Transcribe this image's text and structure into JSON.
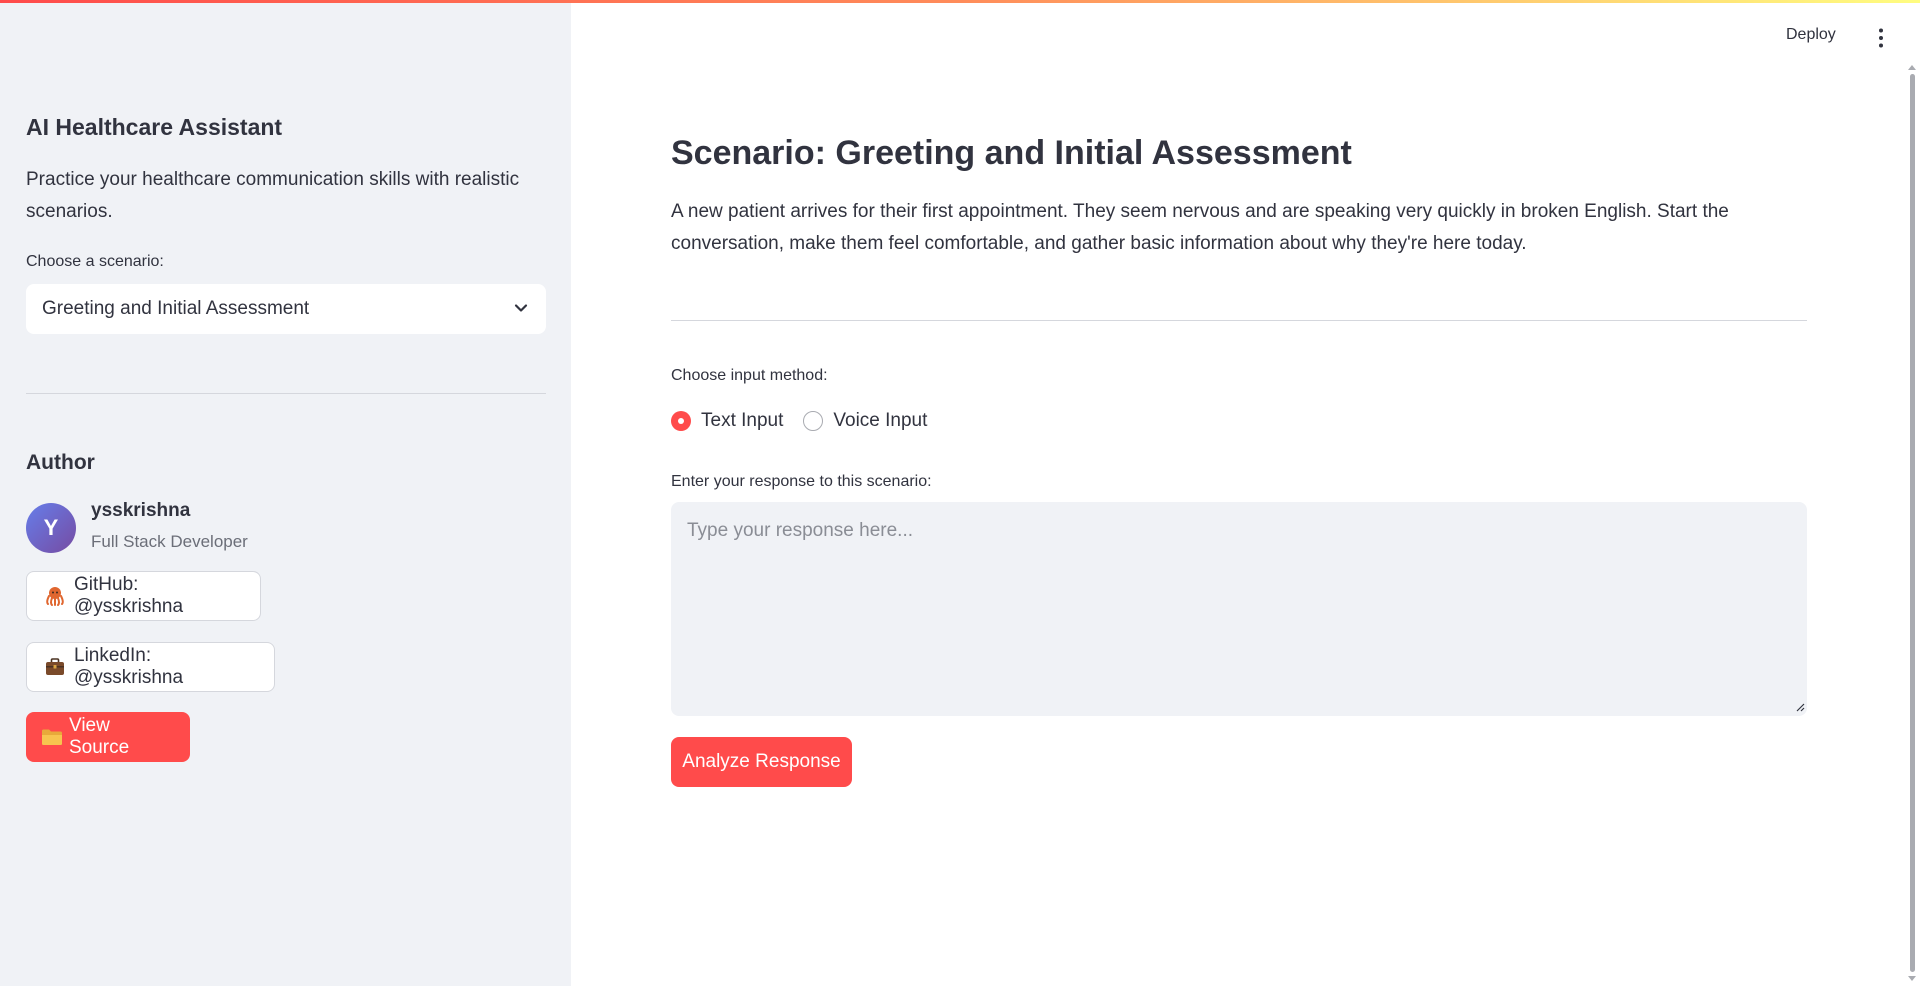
{
  "header": {
    "deploy_label": "Deploy",
    "menu_icon": "vertical-ellipsis-icon"
  },
  "sidebar": {
    "title": "AI Healthcare Assistant",
    "description": "Practice your healthcare communication skills with realistic scenarios.",
    "scenario_label": "Choose a scenario:",
    "scenario_selected": "Greeting and Initial Assessment",
    "author_heading": "Author",
    "author": {
      "initial": "Y",
      "name": "ysskrishna",
      "role": "Full Stack Developer"
    },
    "links": {
      "github_label": "GitHub: @ysskrishna",
      "linkedin_label": "LinkedIn: @ysskrishna",
      "source_label": "View Source"
    }
  },
  "main": {
    "title": "Scenario: Greeting and Initial Assessment",
    "description": "A new patient arrives for their first appointment. They seem nervous and are speaking very quickly in broken English. Start the conversation, make them feel comfortable, and gather basic information about why they're here today.",
    "input_method_label": "Choose input method:",
    "input_options": [
      "Text Input",
      "Voice Input"
    ],
    "selected_input": "Text Input",
    "response_label": "Enter your response to this scenario:",
    "response_placeholder": "Type your response here...",
    "response_value": "",
    "analyze_label": "Analyze Response"
  },
  "colors": {
    "accent": "#ff4b4b",
    "sidebar_bg": "#f0f2f6",
    "text": "#31333f"
  }
}
